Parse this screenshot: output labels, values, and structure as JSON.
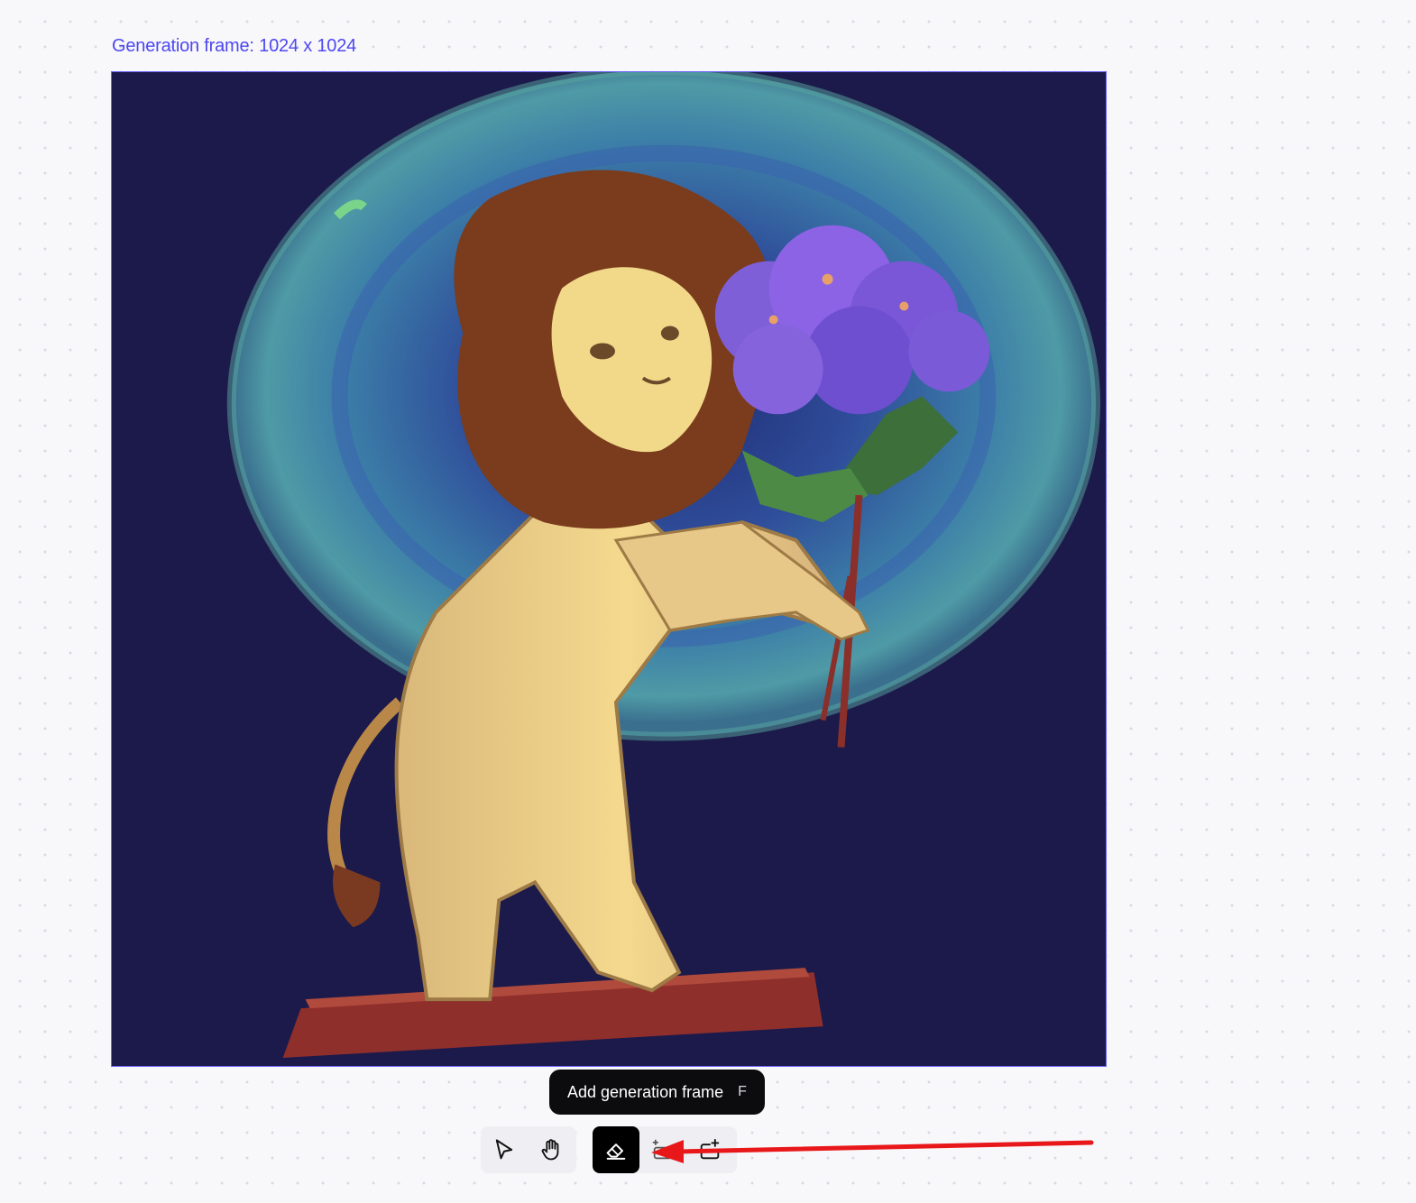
{
  "canvas": {
    "frame_label": "Generation frame: 1024 x 1024",
    "frame_width": 1024,
    "frame_height": 1024,
    "image_description_icon": "lion-with-flowers-image"
  },
  "tooltip": {
    "label": "Add generation frame",
    "shortcut": "F"
  },
  "toolbar": {
    "tools": [
      {
        "name": "select-tool",
        "icon": "cursor-arrow-icon",
        "active": false
      },
      {
        "name": "pan-tool",
        "icon": "hand-icon",
        "active": false
      },
      {
        "name": "eraser-tool",
        "icon": "eraser-icon",
        "active": true
      },
      {
        "name": "add-image-tool",
        "icon": "add-image-icon",
        "active": false
      },
      {
        "name": "add-generation-frame-tool",
        "icon": "add-frame-icon",
        "active": false
      }
    ]
  },
  "colors": {
    "accent": "#4e47f0",
    "annotation_arrow": "#e8181a",
    "canvas_background": "#f8f8fa",
    "tooltip_background": "#0c0c0f"
  }
}
